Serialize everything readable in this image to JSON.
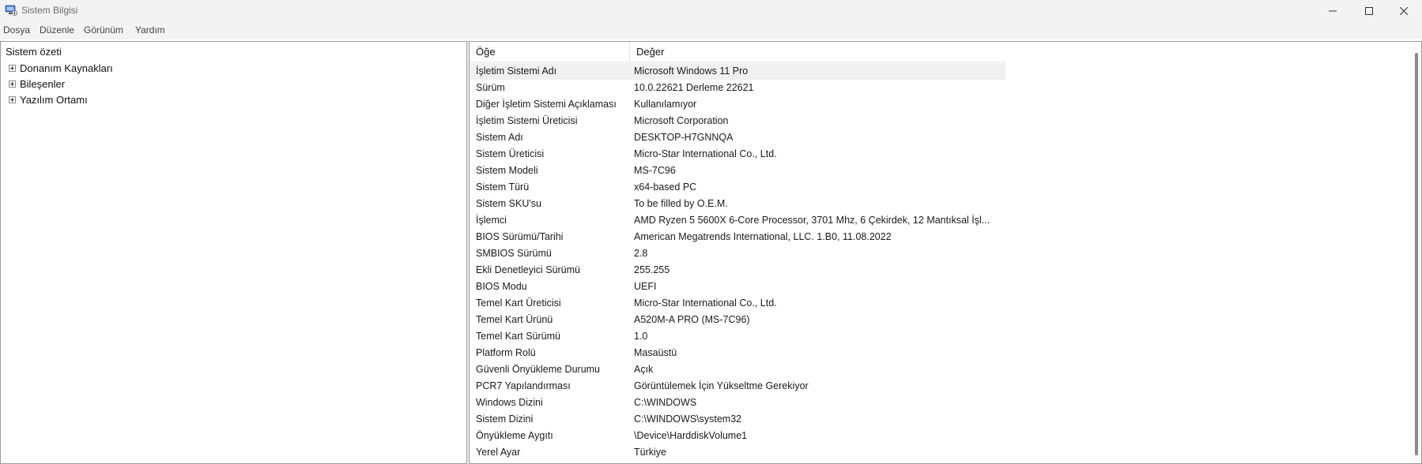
{
  "window": {
    "title": "Sistem Bilgisi"
  },
  "menu": {
    "items": [
      "Dosya",
      "Düzenle",
      "Görünüm",
      "Yardım"
    ]
  },
  "tree": {
    "root": "Sistem özeti",
    "nodes": [
      "Donanım Kaynakları",
      "Bileşenler",
      "Yazılım Ortamı"
    ]
  },
  "table": {
    "headers": [
      "Öğe",
      "Değer"
    ],
    "rows": [
      [
        "İşletim Sistemi Adı",
        "Microsoft Windows 11 Pro"
      ],
      [
        "Sürüm",
        "10.0.22621 Derleme 22621"
      ],
      [
        "Diğer İşletim Sistemi Açıklaması",
        "Kullanılamıyor"
      ],
      [
        "İşletim Sistemi Üreticisi",
        "Microsoft Corporation"
      ],
      [
        "Sistem Adı",
        "DESKTOP-H7GNNQA"
      ],
      [
        "Sistem Üreticisi",
        "Micro-Star International Co., Ltd."
      ],
      [
        "Sistem Modeli",
        "MS-7C96"
      ],
      [
        "Sistem Türü",
        "x64-based PC"
      ],
      [
        "Sistem SKU'su",
        "To be filled by O.E.M."
      ],
      [
        "İşlemci",
        "AMD Ryzen 5 5600X 6-Core Processor, 3701 Mhz, 6 Çekirdek, 12 Mantıksal İşl..."
      ],
      [
        "BIOS Sürümü/Tarihi",
        "American Megatrends International, LLC. 1.B0, 11.08.2022"
      ],
      [
        "SMBIOS Sürümü",
        "2.8"
      ],
      [
        "Ekli Denetleyici Sürümü",
        "255.255"
      ],
      [
        "BIOS Modu",
        "UEFI"
      ],
      [
        "Temel Kart Üreticisi",
        "Micro-Star International Co., Ltd."
      ],
      [
        "Temel Kart Ürünü",
        "A520M-A PRO (MS-7C96)"
      ],
      [
        "Temel Kart Sürümü",
        "1.0"
      ],
      [
        "Platform Rolü",
        "Masaüstü"
      ],
      [
        "Güvenli Önyükleme Durumu",
        "Açık"
      ],
      [
        "PCR7 Yapılandırması",
        "Görüntülemek İçin Yükseltme Gerekiyor"
      ],
      [
        "Windows Dizini",
        "C:\\WINDOWS"
      ],
      [
        "Sistem Dizini",
        "C:\\WINDOWS\\system32"
      ],
      [
        "Önyükleme Aygıtı",
        "\\Device\\HarddiskVolume1"
      ],
      [
        "Yerel Ayar",
        "Türkiye"
      ]
    ]
  },
  "colors": {
    "titlebar_bg": "#f3f3f3",
    "selected_row_bg": "#f0f0f0",
    "pane_border": "#9a9a9a"
  }
}
